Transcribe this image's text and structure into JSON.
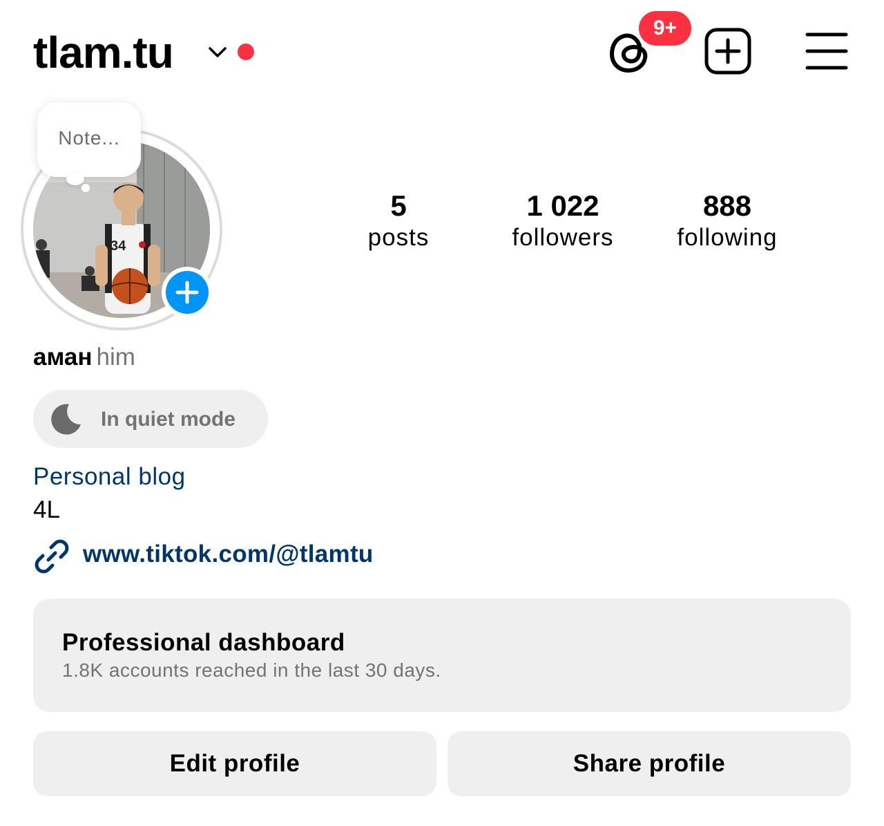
{
  "header": {
    "username": "tlam.tu",
    "threads_badge": "9+",
    "icons": [
      "chevron-down-icon",
      "threads-icon",
      "add-content-icon",
      "menu-icon"
    ],
    "status_dot_color": "#ff3040"
  },
  "profile": {
    "note_placeholder": "Note...",
    "stats": {
      "posts_count": "5",
      "posts_label": "posts",
      "followers_count": "1 022",
      "followers_label": "followers",
      "following_count": "888",
      "following_label": "following"
    },
    "display_name": "аман",
    "pronouns": "him",
    "quiet_mode": "In quiet mode",
    "category": "Personal blog",
    "bio": "4L",
    "link": "www.tiktok.com/@tlamtu"
  },
  "dashboard": {
    "title": "Professional dashboard",
    "subtitle": "1.8K accounts reached in the last 30 days."
  },
  "actions": {
    "edit_profile": "Edit profile",
    "share_profile": "Share profile"
  },
  "colors": {
    "accent_blue": "#0095f6",
    "link_blue": "#00376b",
    "badge_red": "#ff3040",
    "button_gray": "#efefef"
  }
}
